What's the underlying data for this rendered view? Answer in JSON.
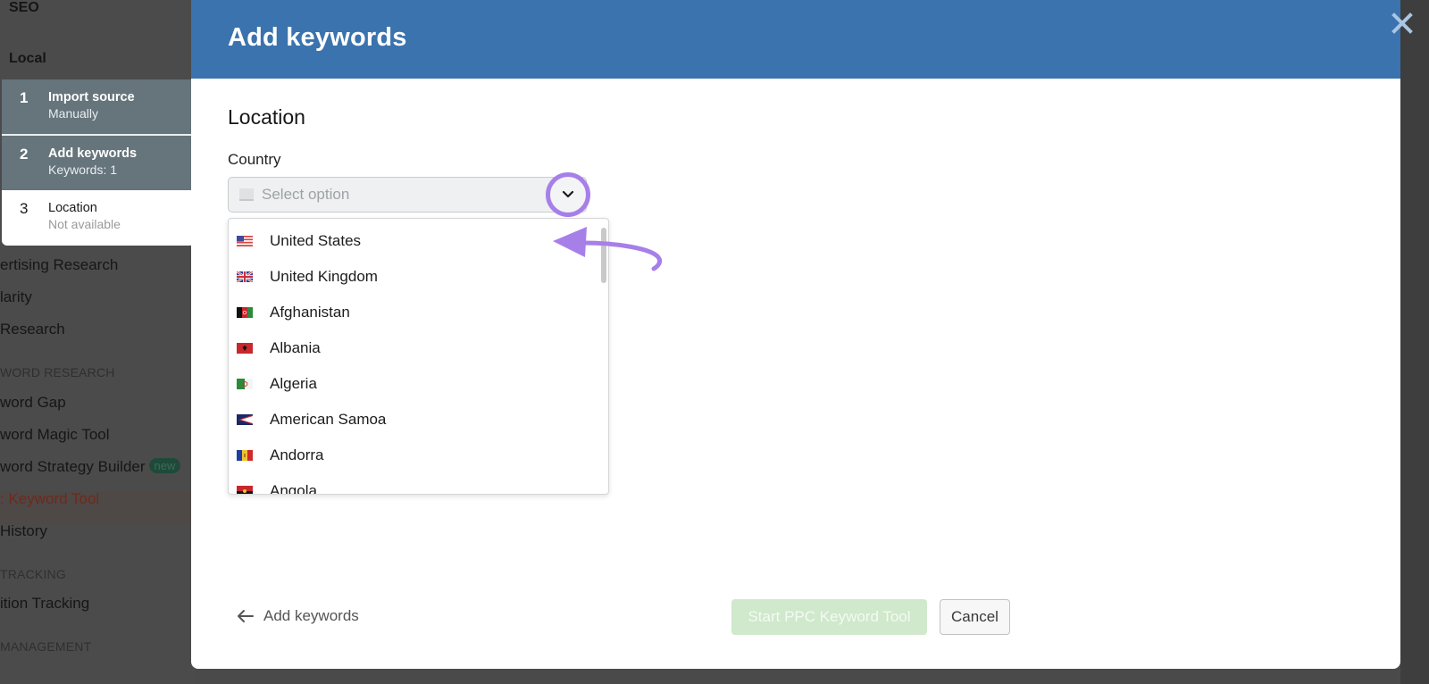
{
  "sidebar": {
    "headings": [
      "SEO",
      "Local"
    ],
    "items": [
      {
        "label": "ertising Research"
      },
      {
        "label": "larity"
      },
      {
        "label": " Research"
      },
      {
        "label": "word Gap"
      },
      {
        "label": "word Magic Tool"
      },
      {
        "label": "word Strategy Builder",
        "badge": "new"
      },
      {
        "label": ": Keyword Tool",
        "active": true
      },
      {
        "label": " History"
      },
      {
        "label": "ition Tracking"
      }
    ],
    "sections": [
      "WORD RESEARCH",
      "TRACKING",
      "MANAGEMENT"
    ]
  },
  "steps": [
    {
      "num": "1",
      "title": "Import source",
      "subtitle": "Manually",
      "state": "done"
    },
    {
      "num": "2",
      "title": "Add keywords",
      "subtitle": "Keywords: 1",
      "state": "done"
    },
    {
      "num": "3",
      "title": "Location",
      "subtitle": "Not available",
      "state": "current"
    }
  ],
  "modal": {
    "title": "Add keywords",
    "section_title": "Location",
    "country_label": "Country",
    "select_placeholder": "Select option",
    "options": [
      {
        "name": "United States",
        "flag": "us-flag"
      },
      {
        "name": "United Kingdom",
        "flag": "uk-flag"
      },
      {
        "name": "Afghanistan",
        "flag": "af-flag"
      },
      {
        "name": "Albania",
        "flag": "al-flag"
      },
      {
        "name": "Algeria",
        "flag": "dz-flag"
      },
      {
        "name": "American Samoa",
        "flag": "as-flag"
      },
      {
        "name": "Andorra",
        "flag": "ad-flag"
      },
      {
        "name": "Angola",
        "flag": "ao-flag"
      }
    ],
    "back_label": "Add keywords",
    "start_label": "Start PPC Keyword Tool",
    "cancel_label": "Cancel"
  },
  "colors": {
    "header": "#3a73ad",
    "annotation": "#a77fe9",
    "start_disabled": "#d0e8cc"
  }
}
